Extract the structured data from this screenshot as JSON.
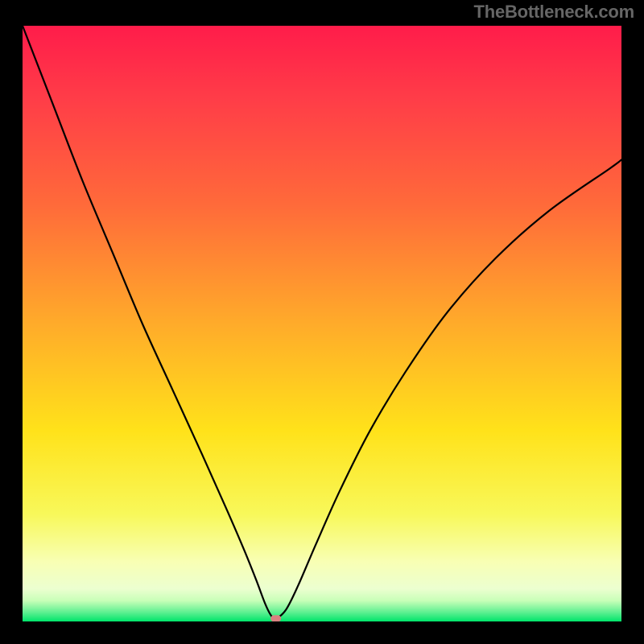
{
  "watermark": "TheBottleneck.com",
  "chart_data": {
    "type": "line",
    "title": "",
    "xlabel": "",
    "ylabel": "",
    "xlim": [
      0,
      100
    ],
    "ylim": [
      0,
      100
    ],
    "gradient_stops": [
      {
        "offset": 0.0,
        "color": "#ff1c4a"
      },
      {
        "offset": 0.12,
        "color": "#ff3c48"
      },
      {
        "offset": 0.3,
        "color": "#ff6a3a"
      },
      {
        "offset": 0.5,
        "color": "#ffab2a"
      },
      {
        "offset": 0.68,
        "color": "#ffe21a"
      },
      {
        "offset": 0.82,
        "color": "#f8f85a"
      },
      {
        "offset": 0.9,
        "color": "#f8ffb4"
      },
      {
        "offset": 0.945,
        "color": "#ecffd0"
      },
      {
        "offset": 0.965,
        "color": "#c8ffb8"
      },
      {
        "offset": 0.985,
        "color": "#5cf090"
      },
      {
        "offset": 1.0,
        "color": "#00e46a"
      }
    ],
    "series": [
      {
        "name": "bottleneck-curve",
        "color": "#000000",
        "x": [
          0,
          5,
          10,
          15,
          20,
          25,
          30,
          34,
          37,
          39,
          40.5,
          41.5,
          42.3,
          44,
          46,
          49,
          53,
          58,
          64,
          71,
          79,
          88,
          98,
          100
        ],
        "values": [
          100,
          87,
          74,
          62,
          50,
          39,
          28,
          19,
          12,
          7,
          3,
          1,
          0.5,
          2,
          6,
          13,
          22,
          32,
          42,
          52,
          61,
          69,
          76,
          77.5
        ]
      }
    ],
    "marker": {
      "x": 42.3,
      "y": 0.5,
      "color": "#d98080"
    }
  }
}
